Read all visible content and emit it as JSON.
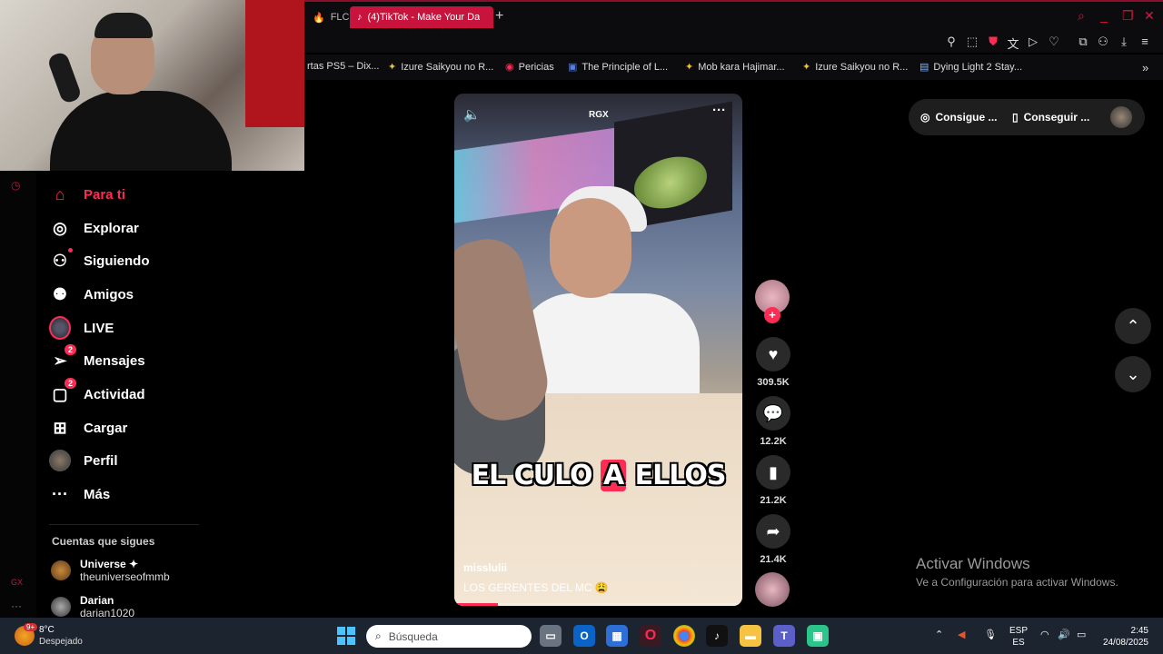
{
  "browser": {
    "tabs": [
      {
        "label": "FLC"
      },
      {
        "label": "(4)TikTok - Make Your Da"
      }
    ],
    "new_tab": "+",
    "bookmarks": [
      {
        "label": "rtas PS5 – Dix..."
      },
      {
        "label": "Izure Saikyou no R..."
      },
      {
        "label": "Pericias"
      },
      {
        "label": "The Principle of L..."
      },
      {
        "label": "Mob kara Hajimar..."
      },
      {
        "label": "Izure Saikyou no R..."
      },
      {
        "label": "Dying Light 2 Stay..."
      }
    ]
  },
  "sidebar": {
    "nav": [
      {
        "label": "Para ti",
        "icon": "home-icon"
      },
      {
        "label": "Explorar",
        "icon": "compass-icon"
      },
      {
        "label": "Siguiendo",
        "icon": "following-icon"
      },
      {
        "label": "Amigos",
        "icon": "friends-icon"
      },
      {
        "label": "LIVE",
        "icon": "live-icon"
      },
      {
        "label": "Mensajes",
        "icon": "messages-icon",
        "badge": "2"
      },
      {
        "label": "Actividad",
        "icon": "activity-icon",
        "badge": "2"
      },
      {
        "label": "Cargar",
        "icon": "upload-icon"
      },
      {
        "label": "Perfil",
        "icon": "profile-icon"
      },
      {
        "label": "Más",
        "icon": "more-icon"
      }
    ],
    "following_title": "Cuentas que sigues",
    "following": [
      {
        "name": "Universe ✦",
        "user": "theuniverseofmmb"
      },
      {
        "name": "Darian",
        "user": "darian1020"
      }
    ],
    "rail_gx": "GX"
  },
  "video": {
    "watermark": "RGX",
    "caption_pre": "EL CULO",
    "caption_hl": "A",
    "caption_post": "ELLOS",
    "username": "misslulii",
    "description": "LOS GERENTES DEL MC 😩",
    "progress": 0.15
  },
  "actions": {
    "likes": "309.5K",
    "comments": "12.2K",
    "saves": "21.2K",
    "shares": "21.4K"
  },
  "right": {
    "get_coins": "Consigue ...",
    "get_app": "Conseguir ...",
    "windows_title": "Activar Windows",
    "windows_sub": "Ve a Configuración para activar Windows."
  },
  "taskbar": {
    "weather_badge": "9+",
    "temp": "8°C",
    "weather": "Despejado",
    "search_placeholder": "Búsqueda",
    "lang_top": "ESP",
    "lang_bottom": "ES",
    "time": "2:45",
    "date": "24/08/2025"
  },
  "colors": {
    "accent": "#fe2c55",
    "opera_red": "#c8143c",
    "taskbar": "#1c2430"
  }
}
